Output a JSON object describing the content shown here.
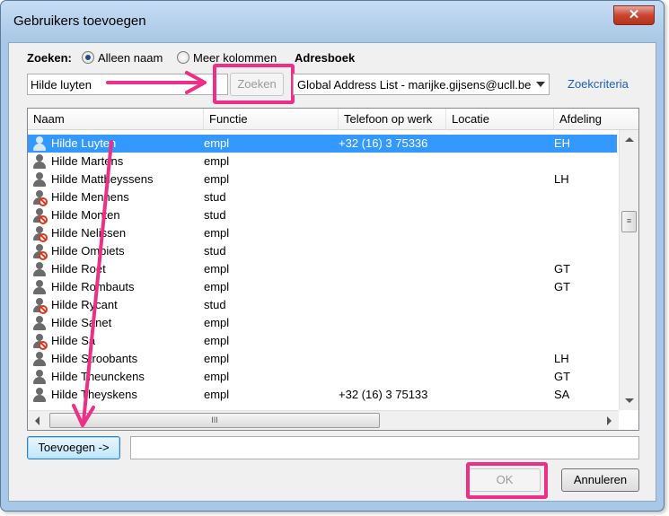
{
  "window": {
    "title": "Gebruikers toevoegen",
    "close_glyph": "✕"
  },
  "search": {
    "label": "Zoeken:",
    "options": [
      {
        "label": "Alleen naam",
        "selected": true
      },
      {
        "label": "Meer kolommen",
        "selected": false
      }
    ],
    "addressbook_label": "Adresboek",
    "query": "Hilde luyten",
    "button_label": "Zoeken",
    "addressbook_value": "Global Address List - marijke.gijsens@ucll.be",
    "criteria_link": "Zoekcriteria"
  },
  "list": {
    "columns": [
      "Naam",
      "Functie",
      "Telefoon op werk",
      "Locatie",
      "Afdeling"
    ],
    "rows": [
      {
        "name": "Hilde Luyten",
        "role": "empl",
        "phone": "+32 (16) 3 75336",
        "location": "",
        "dept": "EH",
        "blocked": false,
        "selected": true
      },
      {
        "name": "Hilde Martens",
        "role": "empl",
        "phone": "",
        "location": "",
        "dept": "",
        "blocked": false,
        "selected": false
      },
      {
        "name": "Hilde Mattheyssens",
        "role": "empl",
        "phone": "",
        "location": "",
        "dept": "LH",
        "blocked": false,
        "selected": false
      },
      {
        "name": "Hilde Mennens",
        "role": "stud",
        "phone": "",
        "location": "",
        "dept": "",
        "blocked": true,
        "selected": false
      },
      {
        "name": "Hilde Monten",
        "role": "stud",
        "phone": "",
        "location": "",
        "dept": "",
        "blocked": true,
        "selected": false
      },
      {
        "name": "Hilde Nelissen",
        "role": "empl",
        "phone": "",
        "location": "",
        "dept": "",
        "blocked": true,
        "selected": false
      },
      {
        "name": "Hilde Ombiets",
        "role": "stud",
        "phone": "",
        "location": "",
        "dept": "",
        "blocked": true,
        "selected": false
      },
      {
        "name": "Hilde Roet",
        "role": "empl",
        "phone": "",
        "location": "",
        "dept": "GT",
        "blocked": false,
        "selected": false
      },
      {
        "name": "Hilde Rombauts",
        "role": "empl",
        "phone": "",
        "location": "",
        "dept": "GT",
        "blocked": false,
        "selected": false
      },
      {
        "name": "Hilde Rycant",
        "role": "stud",
        "phone": "",
        "location": "",
        "dept": "",
        "blocked": true,
        "selected": false
      },
      {
        "name": "Hilde Sanet",
        "role": "empl",
        "phone": "",
        "location": "",
        "dept": "",
        "blocked": false,
        "selected": false
      },
      {
        "name": "Hilde Sa",
        "role": "empl",
        "phone": "",
        "location": "",
        "dept": "",
        "blocked": true,
        "selected": false
      },
      {
        "name": "Hilde Stroobants",
        "role": "empl",
        "phone": "",
        "location": "",
        "dept": "LH",
        "blocked": false,
        "selected": false
      },
      {
        "name": "Hilde Theunckens",
        "role": "empl",
        "phone": "",
        "location": "",
        "dept": "GT",
        "blocked": false,
        "selected": false
      },
      {
        "name": "Hilde Theyskens",
        "role": "empl",
        "phone": "+32 (16) 3 75133",
        "location": "",
        "dept": "SA",
        "blocked": false,
        "selected": false
      }
    ]
  },
  "add_button_label": "Toevoegen ->",
  "added_value": "",
  "ok_label": "OK",
  "cancel_label": "Annuleren",
  "annotation_color": "#ee2f87"
}
